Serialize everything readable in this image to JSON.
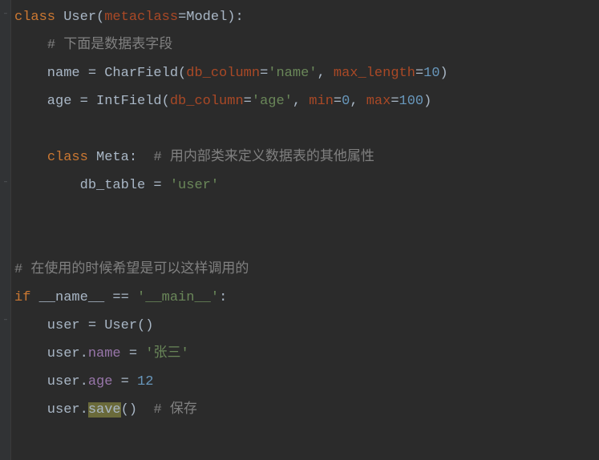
{
  "code": {
    "l1": {
      "class_kw": "class",
      "class_name": " User(",
      "meta_kw": "metaclass",
      "eq": "=",
      "model": "Model):"
    },
    "l2": {
      "indent": "    ",
      "comment": "# 下面是数据表字段"
    },
    "l3": {
      "indent": "    name = CharField(",
      "arg1": "db_column",
      "eq1": "=",
      "str1": "'name'",
      "comma1": ", ",
      "arg2": "max_length",
      "eq2": "=",
      "num1": "10",
      "close": ")"
    },
    "l4": {
      "indent": "    age = IntField(",
      "arg1": "db_column",
      "eq1": "=",
      "str1": "'age'",
      "comma1": ", ",
      "arg2": "min",
      "eq2": "=",
      "num1": "0",
      "comma2": ", ",
      "arg3": "max",
      "eq3": "=",
      "num2": "100",
      "close": ")"
    },
    "l6": {
      "indent": "    ",
      "class_kw": "class",
      "name": " Meta:  ",
      "comment": "# 用内部类来定义数据表的其他属性"
    },
    "l7": {
      "indent": "        db_table = ",
      "str": "'user'"
    },
    "l10": {
      "comment": "# 在使用的时候希望是可以这样调用的"
    },
    "l11": {
      "if_kw": "if",
      "sp": " ",
      "name": "__name__",
      "eq": " == ",
      "str": "'__main__'",
      "colon": ":"
    },
    "l12": {
      "text": "    user = User()"
    },
    "l13": {
      "indent": "    user.",
      "attr": "name",
      "eq": " = ",
      "str": "'张三'"
    },
    "l14": {
      "indent": "    user.",
      "attr": "age",
      "eq": " = ",
      "num": "12"
    },
    "l15": {
      "indent": "    user.",
      "method": "save",
      "call": "()  ",
      "comment": "# 保存"
    }
  }
}
